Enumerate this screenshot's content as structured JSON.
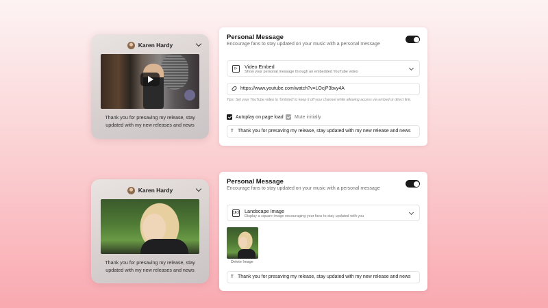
{
  "previews": [
    {
      "artist_name": "Karen Hardy",
      "media": "video",
      "caption": "Thank you for presaving my release, stay updated with my new releases and news"
    },
    {
      "artist_name": "Karen Hardy",
      "media": "image",
      "caption": "Thank you for presaving my release, stay updated with my new releases and news"
    }
  ],
  "cards": [
    {
      "title": "Personal Message",
      "subtitle": "Encourage fans to stay updated on your music with a personal message",
      "toggle_on": true,
      "select": {
        "title": "Video Embed",
        "description": "Show your personal message through an embedded YouTube video",
        "icon": "video-embed-icon"
      },
      "url_value": "https://www.youtube.com/watch?v=LOcjP3bvy4A",
      "tip": "Tips: Set your YouTube video to 'Unlisted' to keep it off your channel while allowing access via embed or direct link.",
      "autoplay_label": "Autoplay on page load",
      "autoplay_checked": true,
      "mute_label": "Mute initially",
      "mute_checked": true,
      "message_value": "Thank you for presaving my release, stay updated with my new release and news"
    },
    {
      "title": "Personal Message",
      "subtitle": "Encourage fans to stay updated on your music with a personal message",
      "toggle_on": true,
      "select": {
        "title": "Landscape Image",
        "description": "Display a square image encouraging your fans to stay updated with you",
        "icon": "landscape-image-icon"
      },
      "delete_label": "Delete Image",
      "message_value": "Thank you for presaving my release, stay updated with my new release and news"
    }
  ],
  "colors": {
    "accent": "#1a1a1a",
    "background_top": "#fdf3f3",
    "background_bottom": "#f9a9b0"
  }
}
